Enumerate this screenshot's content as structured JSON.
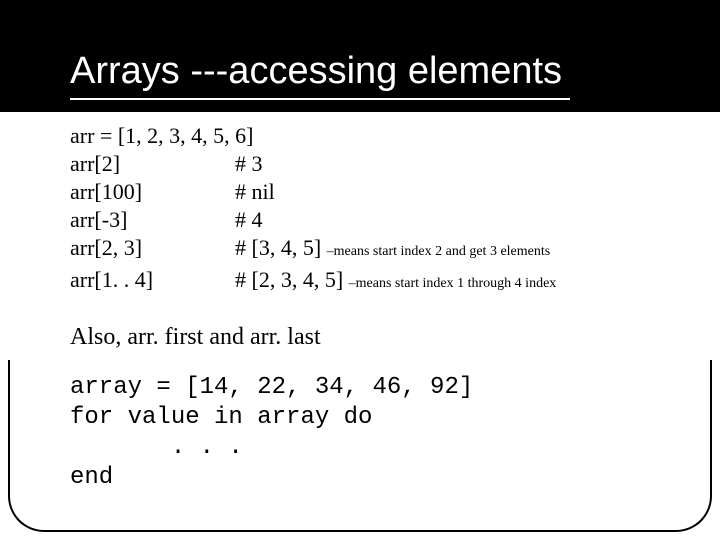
{
  "title": "Arrays ---accessing elements",
  "lines": [
    {
      "left": "arr = [1, 2, 3, 4, 5, 6]",
      "right": "",
      "note": ""
    },
    {
      "left": "arr[2]",
      "right": "#  3",
      "note": ""
    },
    {
      "left": "arr[100]",
      "right": "#  nil",
      "note": ""
    },
    {
      "left": "arr[-3]",
      "right": "#  4",
      "note": ""
    },
    {
      "left": "arr[2, 3]",
      "right": "#  [3, 4, 5] ",
      "note": "–means start index 2 and get 3 elements"
    },
    {
      "left": "arr[1. . 4]",
      "right": "#  [2, 3, 4, 5] ",
      "note": "–means start index 1 through 4 index"
    }
  ],
  "also": "Also, arr. first   and arr. last",
  "code": "array = [14, 22, 34, 46, 92]\nfor value in array do\n       . . .\nend"
}
